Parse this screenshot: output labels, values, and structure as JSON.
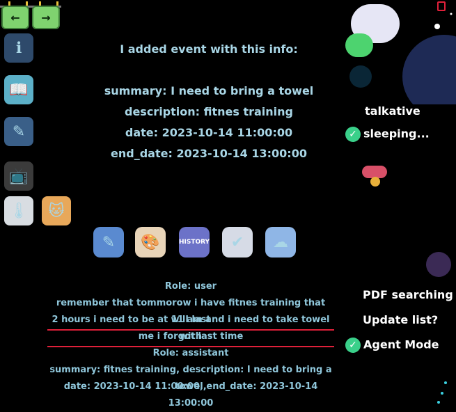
{
  "nav": {
    "back_label": "",
    "forward_label": ""
  },
  "sidebar_icons": [
    "info-laptop-icon",
    "book-icon",
    "eraser-icon",
    "tv-robot-icon",
    "thermometer-home-icon",
    "cat-laptop-icon"
  ],
  "event": {
    "heading": "I added event with this info:",
    "summary": "summary: I need to bring a towel",
    "description": "description: fitnes training",
    "date": "date: 2023-10-14 11:00:00",
    "end_date": "end_date: 2023-10-14 13:00:00"
  },
  "status": {
    "talkative": "talkative",
    "sleeping": "sleeping..."
  },
  "tools": [
    "eraser-icon",
    "palette-icon",
    "history-book-icon",
    "chat-check-icon",
    "cloud-database-icon"
  ],
  "tool_label_history": "HISTORY",
  "chat": {
    "role_user": "Role: user",
    "user_line1": "remember that tommorow i have fitnes training that will last",
    "user_line2": "2 hours i need to be at 11 am and i need to take towel with",
    "user_line3": "me i forgot last time",
    "role_assistant": "Role: assistant",
    "assistant_line1": "summary: fitnes training, description: I need to bring a towel,",
    "assistant_line2": "date: 2023-10-14 11:00:00, end_date: 2023-10-14 13:00:00"
  },
  "right_menu": {
    "pdf": "PDF searching",
    "update": "Update list?",
    "agent": "Agent Mode"
  },
  "colors": {
    "background": "#000000",
    "text_blue": "#a9d6e6",
    "accent_green": "#3ad08a",
    "underline_red": "#e0203a"
  }
}
